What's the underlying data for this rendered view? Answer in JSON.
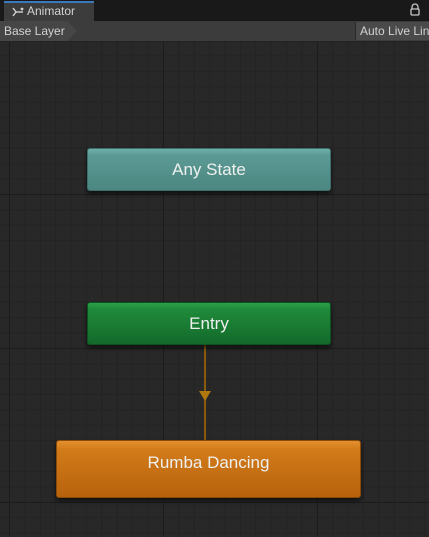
{
  "window": {
    "tab_title": "Animator",
    "tab_icon": "animator-icon",
    "lock_icon": "lock-icon"
  },
  "toolbar": {
    "breadcrumb_layer": "Base Layer",
    "auto_live_link": "Auto Live Lin"
  },
  "graph": {
    "nodes": {
      "any_state": "Any State",
      "entry": "Entry",
      "default_state": "Rumba Dancing"
    },
    "colors": {
      "any_state": "#5c9a95",
      "entry": "#1f8a3a",
      "default_state": "#d27b1a",
      "transition": "#8a5a0a"
    }
  }
}
